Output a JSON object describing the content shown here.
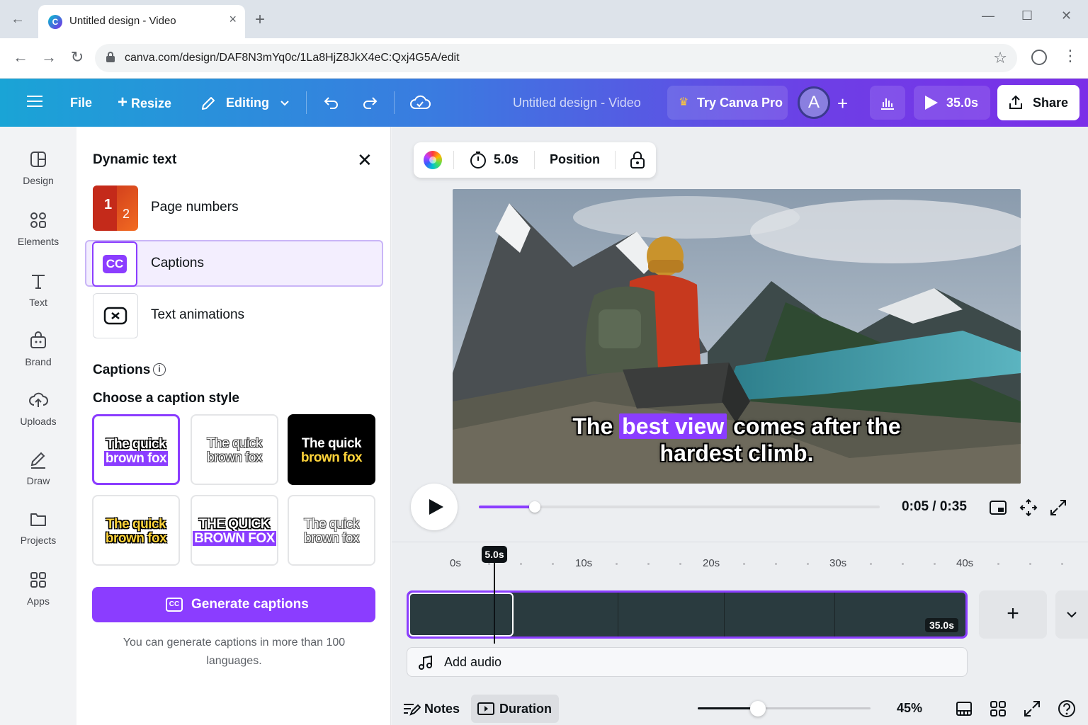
{
  "browser": {
    "tab_title": "Untitled design - Video",
    "url": "canva.com/design/DAF8N3mYq0c/1La8HjZ8JkX4eC:Qxj4G5A/edit"
  },
  "header": {
    "file": "File",
    "resize": "Resize",
    "editing": "Editing",
    "design_title": "Untitled design - Video",
    "try_pro": "Try Canva Pro",
    "avatar_initial": "A",
    "duration": "35.0s",
    "share": "Share"
  },
  "rail": {
    "items": [
      {
        "label": "Design",
        "icon": "design-icon"
      },
      {
        "label": "Elements",
        "icon": "elements-icon"
      },
      {
        "label": "Text",
        "icon": "text-icon"
      },
      {
        "label": "Brand",
        "icon": "brand-icon"
      },
      {
        "label": "Uploads",
        "icon": "uploads-icon"
      },
      {
        "label": "Draw",
        "icon": "draw-icon"
      },
      {
        "label": "Projects",
        "icon": "projects-icon"
      },
      {
        "label": "Apps",
        "icon": "apps-icon"
      }
    ]
  },
  "panel": {
    "title": "Dynamic text",
    "options": [
      {
        "label": "Page numbers",
        "thumb_num_1": "1",
        "thumb_num_2": "2"
      },
      {
        "label": "Captions",
        "thumb_text": "CC"
      },
      {
        "label": "Text animations"
      }
    ],
    "section_title": "Captions",
    "choose_title": "Choose a caption style",
    "styles": [
      {
        "line1": "The quick",
        "line2": "brown fox"
      },
      {
        "line1": "The quick",
        "line2": "brown fox"
      },
      {
        "line1": "The quick",
        "line2": "brown fox"
      },
      {
        "line1": "The quick",
        "line2": "brown fox"
      },
      {
        "line1": "THE QUICK",
        "line2": "BROWN FOX"
      },
      {
        "line1": "The quick",
        "line2": "brown fox"
      }
    ],
    "generate_button": "Generate captions",
    "generate_icon_text": "CC",
    "note": "You can generate captions in more than 100 languages."
  },
  "toolbar": {
    "duration": "5.0s",
    "position": "Position"
  },
  "canvas": {
    "caption_pre": "The ",
    "caption_highlight": "best view",
    "caption_post": " comes after the",
    "caption_line2": "hardest climb."
  },
  "player": {
    "time": "0:05 / 0:35",
    "progress_fraction": 0.14
  },
  "timeline": {
    "playhead_label": "5.0s",
    "ticks": [
      "0s",
      "10s",
      "20s",
      "30s",
      "40s"
    ],
    "track_duration": "35.0s",
    "add_audio": "Add audio"
  },
  "bottom": {
    "notes": "Notes",
    "duration": "Duration",
    "zoom": "45%",
    "zoom_fraction": 0.35
  },
  "colors": {
    "accent": "#8b3dff",
    "header_start": "#1aa4d6",
    "header_end": "#7b2fe8"
  }
}
